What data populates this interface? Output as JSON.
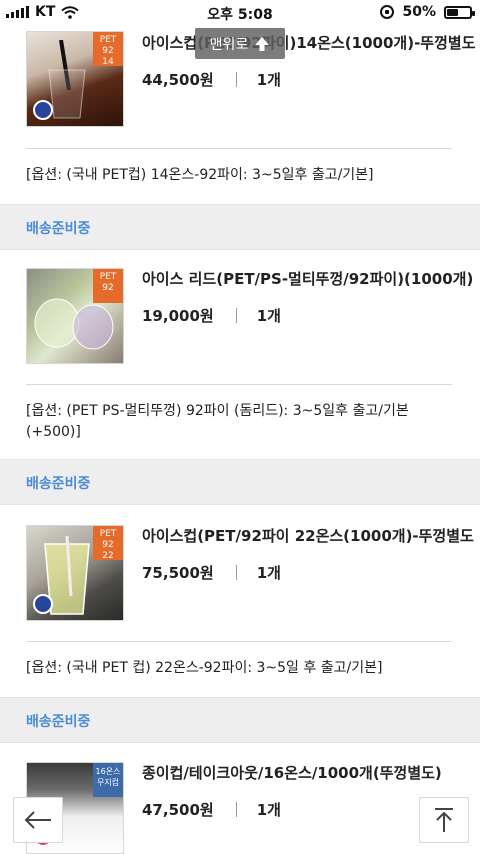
{
  "status_bar": {
    "carrier": "KT",
    "time": "오후 5:08",
    "battery_percent": "50%",
    "battery_level": 0.5
  },
  "scroll_top_tooltip": {
    "label": "맨위로",
    "icon": "arrow-up-icon"
  },
  "orders": [
    {
      "title": "아이스컵(PET/92파이)14온스(1000개)-뚜껑별도",
      "price": "44,500원",
      "quantity": "1개",
      "badge": "PET 92 14",
      "option": "[옵션: (국내 PET컵) 14온스-92파이: 3~5일후 출고/기본]",
      "status": "배송준비중"
    },
    {
      "title": "아이스 리드(PET/PS-멀티뚜껑/92파이)(1000개)",
      "price": "19,000원",
      "quantity": "1개",
      "badge": "PET 92",
      "option": "[옵션: (PET PS-멀티뚜껑) 92파이 (돔리드): 3~5일후 출고/기본 (+500)]",
      "status": "배송준비중"
    },
    {
      "title": "아이스컵(PET/92파이 22온스(1000개)-뚜껑별도",
      "price": "75,500원",
      "quantity": "1개",
      "badge": "PET 92 22",
      "option": "[옵션: (국내 PET 컵) 22온스-92파이: 3~5일 후 출고/기본]",
      "status": "배송준비중"
    },
    {
      "title": "종이컵/테이크아웃/16온스/1000개(뚜껑별도)",
      "price": "47,500원",
      "quantity": "1개",
      "badge": "16온스 무지컵"
    }
  ],
  "floating_nav": {
    "back_icon": "arrow-left-icon",
    "top_icon": "arrow-top-icon"
  },
  "colors": {
    "accent_blue": "#4a8cd6",
    "badge_orange": "#e66a2a",
    "band_grey": "#eeeeee"
  }
}
